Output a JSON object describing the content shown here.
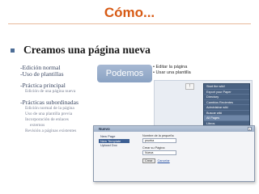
{
  "slide": {
    "title": "Cómo...",
    "bullet": "Creamos una página nueva"
  },
  "left_column": {
    "items": [
      {
        "label": "-Edición normal",
        "level": 1
      },
      {
        "label": "-Uso de plantillas",
        "level": 1
      },
      {
        "label": "-Práctica principal",
        "level": 1
      },
      {
        "label": "Edición de una página nueva",
        "level": 2
      },
      {
        "label": "-Prácticas subordinadas",
        "level": 1
      },
      {
        "label": "Edición normal de la página",
        "level": 2
      },
      {
        "label": "Uso de una plantilla previa",
        "level": 2
      },
      {
        "label": "Incorporación de enlaces",
        "level": 2
      },
      {
        "label": "externos",
        "level": 3
      },
      {
        "label": "Revisión a páginas existentes",
        "level": 2
      }
    ]
  },
  "podemos": {
    "button_label": "Podemos",
    "items": [
      "• Editar la página",
      "• Usar una plantilla"
    ]
  },
  "side_panel": {
    "button_label": "!",
    "menu": [
      {
        "label": "Start the wiki!",
        "selected": false
      },
      {
        "label": "Export your Paper",
        "selected": false
      },
      {
        "label": "Directory",
        "selected": false
      },
      {
        "label": "Cambios Recientes",
        "selected": false
      },
      {
        "label": "Administrar wiki",
        "selected": false
      },
      {
        "label": "Buscar wiki",
        "selected": false
      },
      {
        "label": "All Pages",
        "selected": true
      },
      {
        "label": "Libros",
        "selected": false
      },
      {
        "label": "Herramientas",
        "selected": false
      }
    ]
  },
  "dialog": {
    "title": "Nuevo",
    "close_label": "x",
    "list": [
      {
        "label": "New Page",
        "selected": false
      },
      {
        "label": "New Template",
        "selected": true
      },
      {
        "label": "Upload Doc",
        "selected": false
      }
    ],
    "form": {
      "name_label": "Nombre de la pequeña",
      "name_value": "prueba",
      "page_label": "Crear su Página",
      "page_value": "Nueva",
      "create_button": "Crear",
      "cancel_link": "Cancelar"
    }
  },
  "colors": {
    "title": "#d75a14",
    "bullet_square": "#4d6d96",
    "podemos_bg": "#8aa2c3",
    "menu_bg": "#4a6282",
    "dialog_bg": "#f3f4f7"
  }
}
